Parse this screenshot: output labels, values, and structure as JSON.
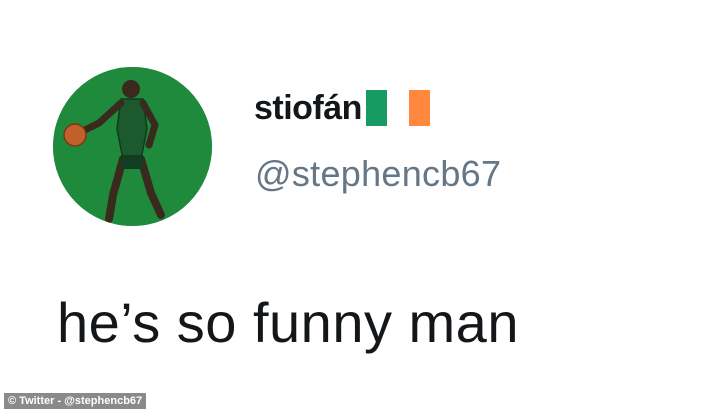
{
  "tweet": {
    "display_name": "stiofán",
    "flag_emoji": "irish-flag",
    "flag_colors": [
      "#169b62",
      "#ffffff",
      "#ff883e"
    ],
    "handle": "@stephencb67",
    "text": "he’s so funny man",
    "avatar_background": "#1f8a3b"
  },
  "credit": {
    "label": "© Twitter - @stephencb67"
  }
}
